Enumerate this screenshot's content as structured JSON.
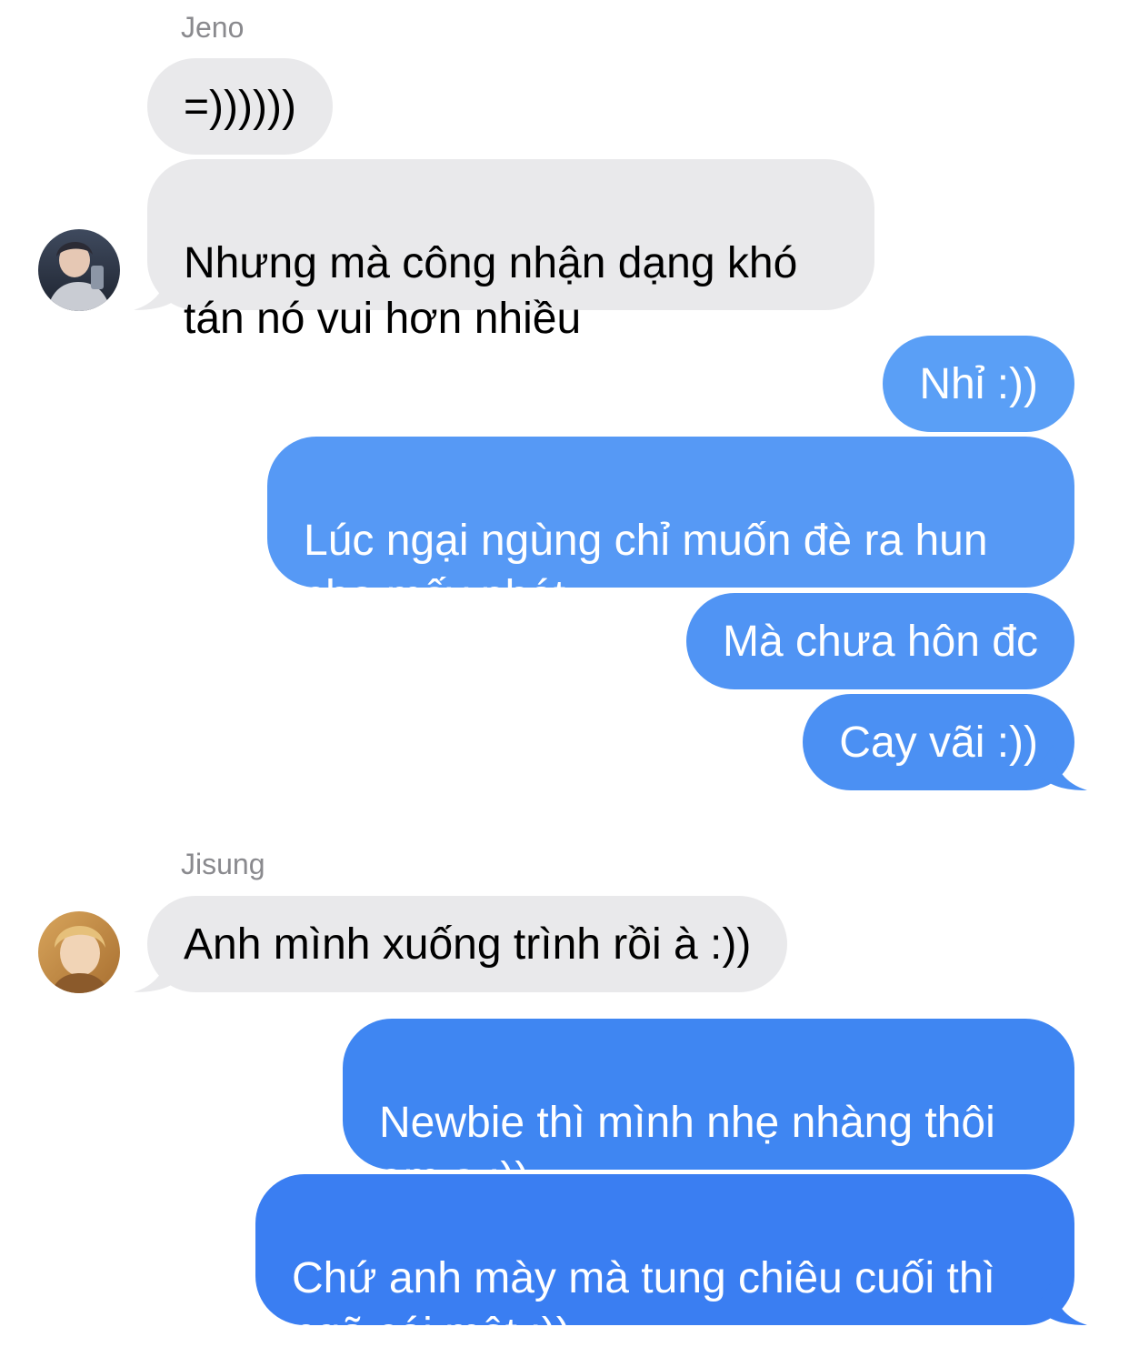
{
  "conversation": {
    "groups": [
      {
        "sender": "Jeno",
        "messages": [
          "=))))))",
          "Nhưng mà công nhận dạng khó\ntán nó vui hơn nhiều"
        ]
      },
      {
        "sender": "me",
        "messages": [
          "Nhỉ :))",
          "Lúc ngại ngùng chỉ muốn đè ra hun\ncho mấy phát",
          "Mà chưa hôn đc",
          "Cay vãi :))"
        ]
      },
      {
        "sender": "Jisung",
        "messages": [
          "Anh mình xuống trình rồi à :))"
        ]
      },
      {
        "sender": "me",
        "messages": [
          "Newbie thì mình nhẹ nhàng thôi\nem ạ :))",
          "Chứ anh mày mà tung chiêu cuối thì\nngã cái một :))"
        ]
      }
    ]
  },
  "labels": {
    "jeno": "Jeno",
    "jisung": "Jisung"
  },
  "colors": {
    "incoming_bubble": "#e9e9eb",
    "outgoing_gradient_top": "#5aa2f7",
    "outgoing_gradient_bottom": "#3a7ef2",
    "sender_name": "#8a8a8e"
  },
  "icons": {
    "jeno_avatar": "avatar-photo",
    "jisung_avatar": "avatar-photo"
  }
}
